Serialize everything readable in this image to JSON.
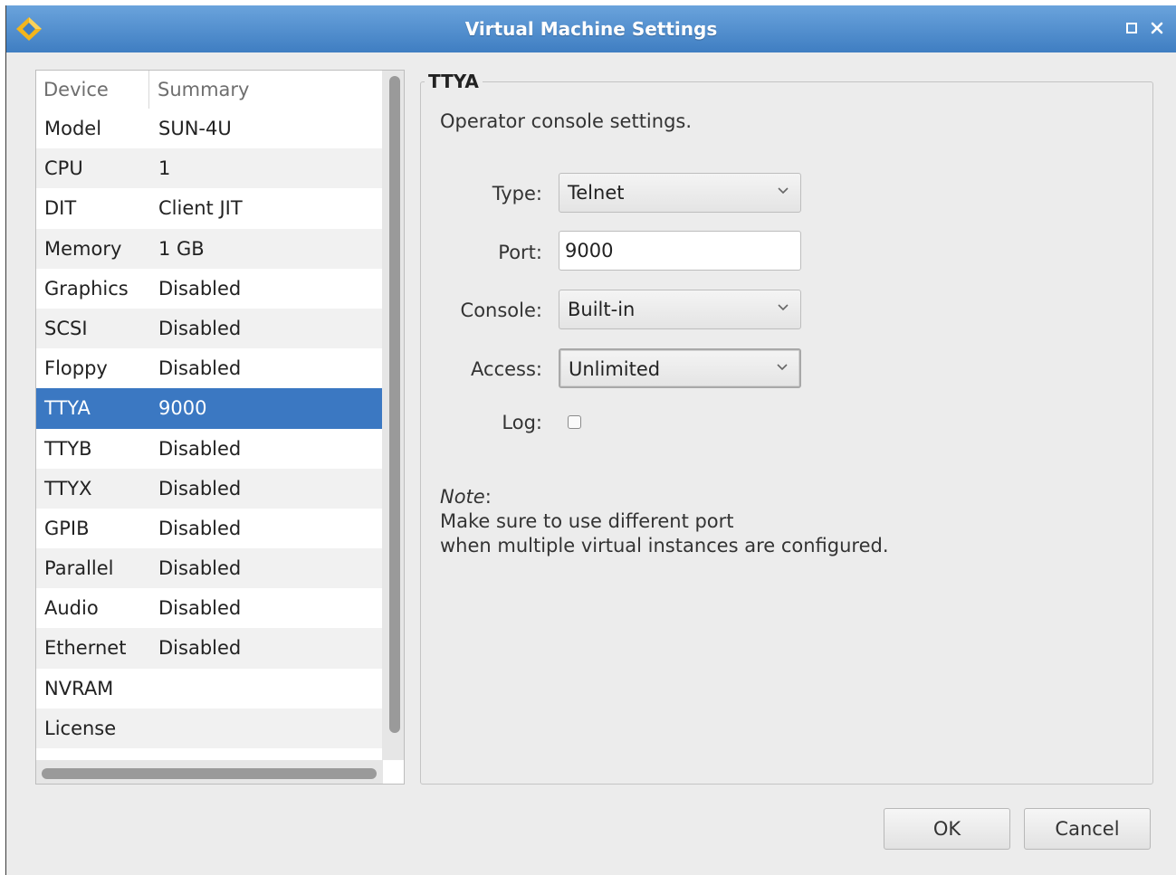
{
  "window": {
    "title": "Virtual Machine Settings",
    "accent": "#3b78c2"
  },
  "device_list": {
    "headers": [
      "Device",
      "Summary"
    ],
    "rows": [
      {
        "device": "Model",
        "summary": "SUN-4U"
      },
      {
        "device": "CPU",
        "summary": "1"
      },
      {
        "device": "DIT",
        "summary": "Client JIT"
      },
      {
        "device": "Memory",
        "summary": "1 GB"
      },
      {
        "device": "Graphics",
        "summary": "Disabled"
      },
      {
        "device": "SCSI",
        "summary": "Disabled"
      },
      {
        "device": "Floppy",
        "summary": "Disabled"
      },
      {
        "device": "TTYA",
        "summary": "9000"
      },
      {
        "device": "TTYB",
        "summary": "Disabled"
      },
      {
        "device": "TTYX",
        "summary": "Disabled"
      },
      {
        "device": "GPIB",
        "summary": "Disabled"
      },
      {
        "device": "Parallel",
        "summary": "Disabled"
      },
      {
        "device": "Audio",
        "summary": "Disabled"
      },
      {
        "device": "Ethernet",
        "summary": "Disabled"
      },
      {
        "device": "NVRAM",
        "summary": ""
      },
      {
        "device": "License",
        "summary": ""
      }
    ],
    "selected_index": 7
  },
  "settings": {
    "group_title": "TTYA",
    "description": "Operator console settings.",
    "type_label": "Type:",
    "type_value": "Telnet",
    "port_label": "Port:",
    "port_value": "9000",
    "console_label": "Console:",
    "console_value": "Built-in",
    "access_label": "Access:",
    "access_value": "Unlimited",
    "log_label": "Log:",
    "log_checked": false,
    "note_title": "Note",
    "note_colon": ":",
    "note_line1": "Make sure to use different port",
    "note_line2": "when multiple virtual instances are configured."
  },
  "buttons": {
    "ok": "OK",
    "cancel": "Cancel"
  }
}
